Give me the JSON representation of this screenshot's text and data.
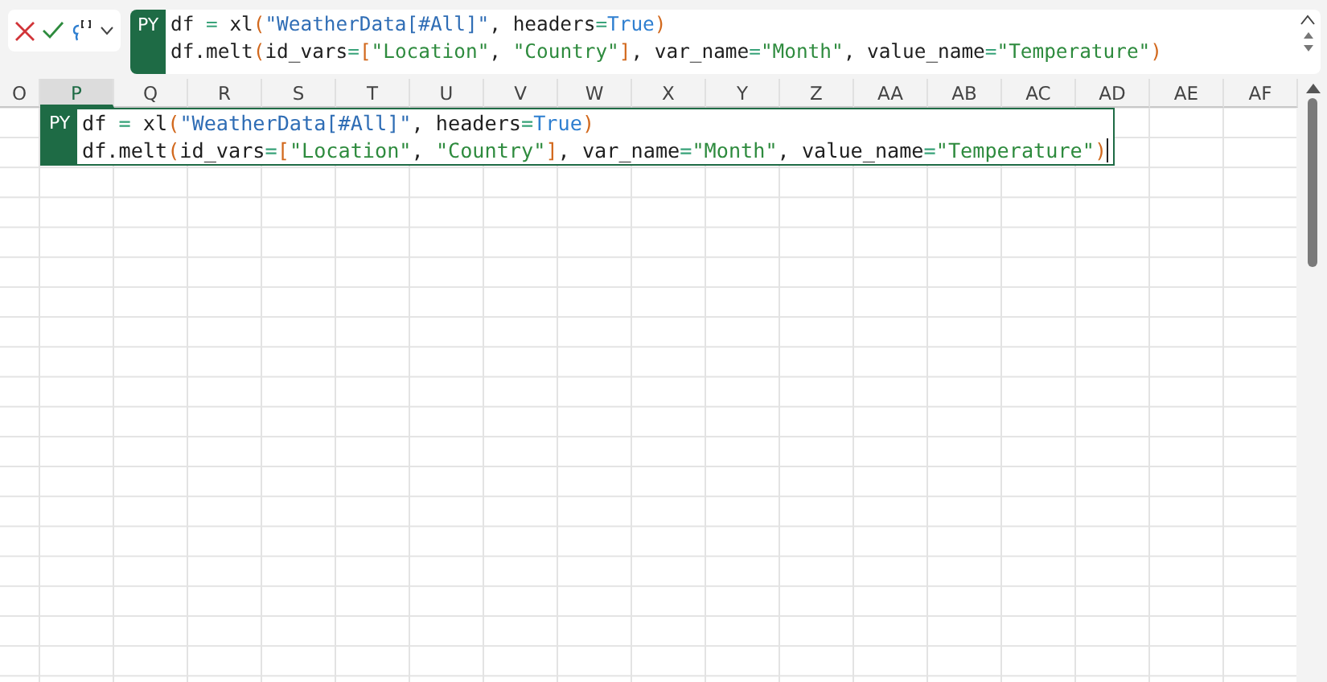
{
  "formula_bar": {
    "badge": "PY",
    "lines": [
      [
        {
          "kind": "plain",
          "text": "df "
        },
        {
          "kind": "op",
          "text": "="
        },
        {
          "kind": "plain",
          "text": " xl"
        },
        {
          "kind": "paren",
          "text": "("
        },
        {
          "kind": "string",
          "text": "\"WeatherData[#All]\""
        },
        {
          "kind": "plain",
          "text": ", headers"
        },
        {
          "kind": "op",
          "text": "="
        },
        {
          "kind": "keyword",
          "text": "True"
        },
        {
          "kind": "paren",
          "text": ")"
        }
      ],
      [
        {
          "kind": "plain",
          "text": "df.melt"
        },
        {
          "kind": "paren",
          "text": "("
        },
        {
          "kind": "plain",
          "text": "id_vars"
        },
        {
          "kind": "op",
          "text": "="
        },
        {
          "kind": "paren",
          "text": "["
        },
        {
          "kind": "arg-string",
          "text": "\"Location\""
        },
        {
          "kind": "plain",
          "text": ", "
        },
        {
          "kind": "arg-string",
          "text": "\"Country\""
        },
        {
          "kind": "paren",
          "text": "]"
        },
        {
          "kind": "plain",
          "text": ", var_name"
        },
        {
          "kind": "op",
          "text": "="
        },
        {
          "kind": "arg-string",
          "text": "\"Month\""
        },
        {
          "kind": "plain",
          "text": ", value_name"
        },
        {
          "kind": "op",
          "text": "="
        },
        {
          "kind": "arg-string",
          "text": "\"Temperature\""
        },
        {
          "kind": "paren",
          "text": ")"
        }
      ]
    ]
  },
  "columns": [
    {
      "label": "O",
      "selected": false
    },
    {
      "label": "P",
      "selected": true
    },
    {
      "label": "Q",
      "selected": false
    },
    {
      "label": "R",
      "selected": false
    },
    {
      "label": "S",
      "selected": false
    },
    {
      "label": "T",
      "selected": false
    },
    {
      "label": "U",
      "selected": false
    },
    {
      "label": "V",
      "selected": false
    },
    {
      "label": "W",
      "selected": false
    },
    {
      "label": "X",
      "selected": false
    },
    {
      "label": "Y",
      "selected": false
    },
    {
      "label": "Z",
      "selected": false
    },
    {
      "label": "AA",
      "selected": false
    },
    {
      "label": "AB",
      "selected": false
    },
    {
      "label": "AC",
      "selected": false
    },
    {
      "label": "AD",
      "selected": false
    },
    {
      "label": "AE",
      "selected": false
    },
    {
      "label": "AF",
      "selected": false
    }
  ],
  "active_cell": {
    "badge": "PY",
    "lines": [
      [
        {
          "kind": "plain",
          "text": "df "
        },
        {
          "kind": "op",
          "text": "="
        },
        {
          "kind": "plain",
          "text": " xl"
        },
        {
          "kind": "paren",
          "text": "("
        },
        {
          "kind": "string",
          "text": "\"WeatherData[#All]\""
        },
        {
          "kind": "plain",
          "text": ", headers"
        },
        {
          "kind": "op",
          "text": "="
        },
        {
          "kind": "keyword",
          "text": "True"
        },
        {
          "kind": "paren",
          "text": ")"
        }
      ],
      [
        {
          "kind": "plain",
          "text": "df.melt"
        },
        {
          "kind": "paren",
          "text": "("
        },
        {
          "kind": "plain",
          "text": "id_vars"
        },
        {
          "kind": "op",
          "text": "="
        },
        {
          "kind": "paren",
          "text": "["
        },
        {
          "kind": "arg-string",
          "text": "\"Location\""
        },
        {
          "kind": "plain",
          "text": ", "
        },
        {
          "kind": "arg-string",
          "text": "\"Country\""
        },
        {
          "kind": "paren",
          "text": "]"
        },
        {
          "kind": "plain",
          "text": ", var_name"
        },
        {
          "kind": "op",
          "text": "="
        },
        {
          "kind": "arg-string",
          "text": "\"Month\""
        },
        {
          "kind": "plain",
          "text": ", value_name"
        },
        {
          "kind": "op",
          "text": "="
        },
        {
          "kind": "arg-string",
          "text": "\"Temperature\""
        },
        {
          "kind": "paren",
          "text": ")"
        }
      ]
    ]
  }
}
